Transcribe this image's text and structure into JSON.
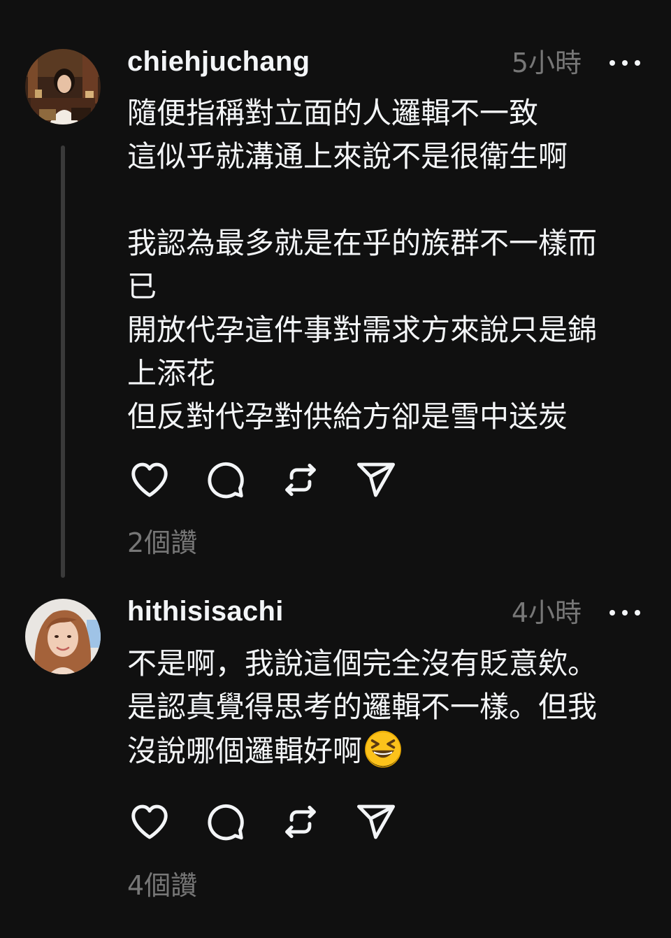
{
  "posts": [
    {
      "username": "chiehjuchang",
      "time": "5小時",
      "text": "隨便指稱對立面的人邏輯不一致\n這似乎就溝通上來說不是很衛生啊\n\n我認為最多就是在乎的族群不一樣而\n已\n開放代孕這件事對需求方來說只是錦\n上添花\n但反對代孕對供給方卻是雪中送炭",
      "likes": "2個讚",
      "avatar_icon": "avatar-photo-woman-in-shop",
      "has_thread_line": true
    },
    {
      "username": "hithisisachi",
      "time": "4小時",
      "text": "不是啊，我說這個完全沒有貶意欸。\n是認真覺得思考的邏輯不一樣。但我\n沒說哪個邏輯好啊",
      "emoji": "grinning-squinting-face-emoji",
      "likes": "4個讚",
      "avatar_icon": "avatar-photo-woman-selfie",
      "has_thread_line": false
    }
  ],
  "icons": {
    "like": "heart-icon",
    "reply": "comment-icon",
    "repost": "repost-icon",
    "share": "send-icon",
    "more": "more-icon"
  },
  "colors": {
    "background": "#101010",
    "primary_text": "#f3f5f7",
    "secondary_text": "#777777",
    "thread_line": "#3a3a3a"
  }
}
